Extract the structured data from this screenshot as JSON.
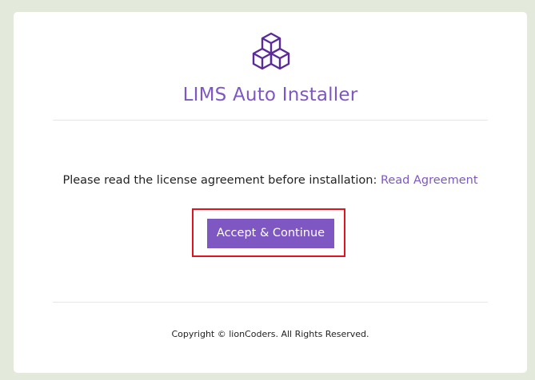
{
  "app": {
    "title": "LIMS Auto Installer",
    "logo_icon": "cubes-icon",
    "accent_color": "#7e57c2",
    "background_color": "#e3eadb"
  },
  "main": {
    "notice_text": "Please read the license agreement before installation: ",
    "agreement_link": "Read Agreement",
    "continue_button": "Accept & Continue",
    "highlight_color": "#e0141e"
  },
  "footer": {
    "copyright": "Copyright © lionCoders. All Rights Reserved."
  }
}
